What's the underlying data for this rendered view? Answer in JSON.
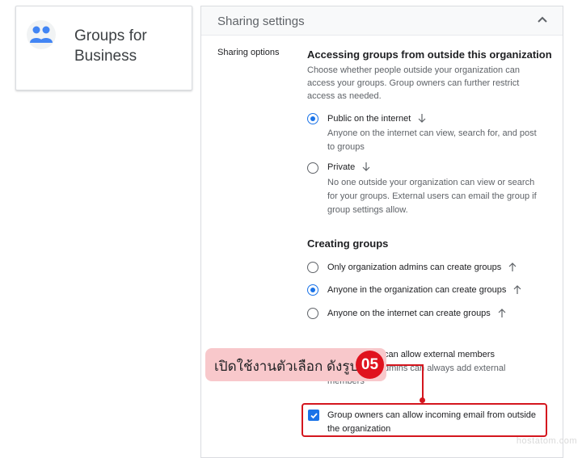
{
  "app": {
    "title": "Groups for Business",
    "icon": "groups-icon"
  },
  "panel": {
    "title": "Sharing settings",
    "section_label": "Sharing options",
    "outside": {
      "heading": "Accessing groups from outside this organization",
      "description": "Choose whether people outside your organization can access your groups. Group owners can further restrict access as needed.",
      "options": [
        {
          "label": "Public on the internet",
          "description": "Anyone on the internet can view, search for, and post to groups",
          "selected": true,
          "arrow": "down"
        },
        {
          "label": "Private",
          "description": "No one outside your organization can view or search for your groups. External users can email the group if group settings allow.",
          "selected": false,
          "arrow": "down"
        }
      ]
    },
    "creating": {
      "heading": "Creating groups",
      "options": [
        {
          "label": "Only organization admins can create groups",
          "selected": false,
          "arrow": "up"
        },
        {
          "label": "Anyone in the organization can create groups",
          "selected": true,
          "arrow": "up"
        },
        {
          "label": "Anyone on the internet can create groups",
          "selected": false,
          "arrow": "up"
        }
      ]
    },
    "external_members": {
      "label_part": "can allow external members",
      "desc_part": "dmins can always add external",
      "desc_part2": "members"
    },
    "incoming_email": {
      "label": "Group owners can allow incoming email from outside the organization",
      "checked": true
    }
  },
  "annotation": {
    "callout": "เปิดใช้งานตัวเลือก ดังรูป",
    "step": "05"
  },
  "watermark": "hostatom.com",
  "colors": {
    "accent": "#1a73e8",
    "highlight": "#d4161e",
    "callout_bg": "#f8c8cb"
  }
}
